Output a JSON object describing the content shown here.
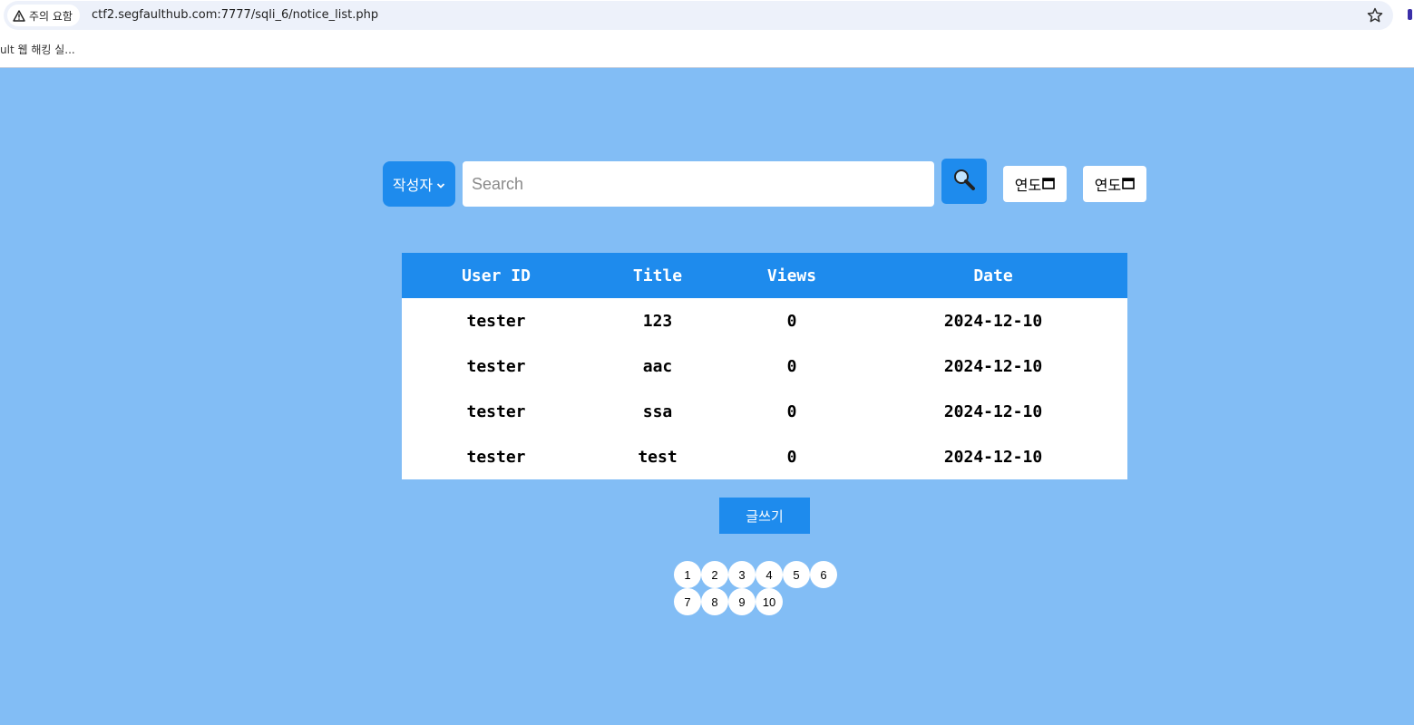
{
  "browser": {
    "security_label": "주의 요함",
    "url": "ctf2.segfaulthub.com:7777/sqli_6/notice_list.php",
    "bookmark": "ult 웹 해킹 실..."
  },
  "search": {
    "category": "작성자",
    "placeholder": "Search",
    "value": "",
    "date_from": "연도",
    "date_to": "연도"
  },
  "table": {
    "headers": [
      "User ID",
      "Title",
      "Views",
      "Date"
    ],
    "rows": [
      [
        "tester",
        "123",
        "0",
        "2024-12-10"
      ],
      [
        "tester",
        "aac",
        "0",
        "2024-12-10"
      ],
      [
        "tester",
        "ssa",
        "0",
        "2024-12-10"
      ],
      [
        "tester",
        "test",
        "0",
        "2024-12-10"
      ]
    ]
  },
  "write_button": "글쓰기",
  "pagination": [
    "1",
    "2",
    "3",
    "4",
    "5",
    "6",
    "7",
    "8",
    "9",
    "10"
  ],
  "colors": {
    "background": "#82bdf5",
    "accent": "#1e8bed"
  }
}
